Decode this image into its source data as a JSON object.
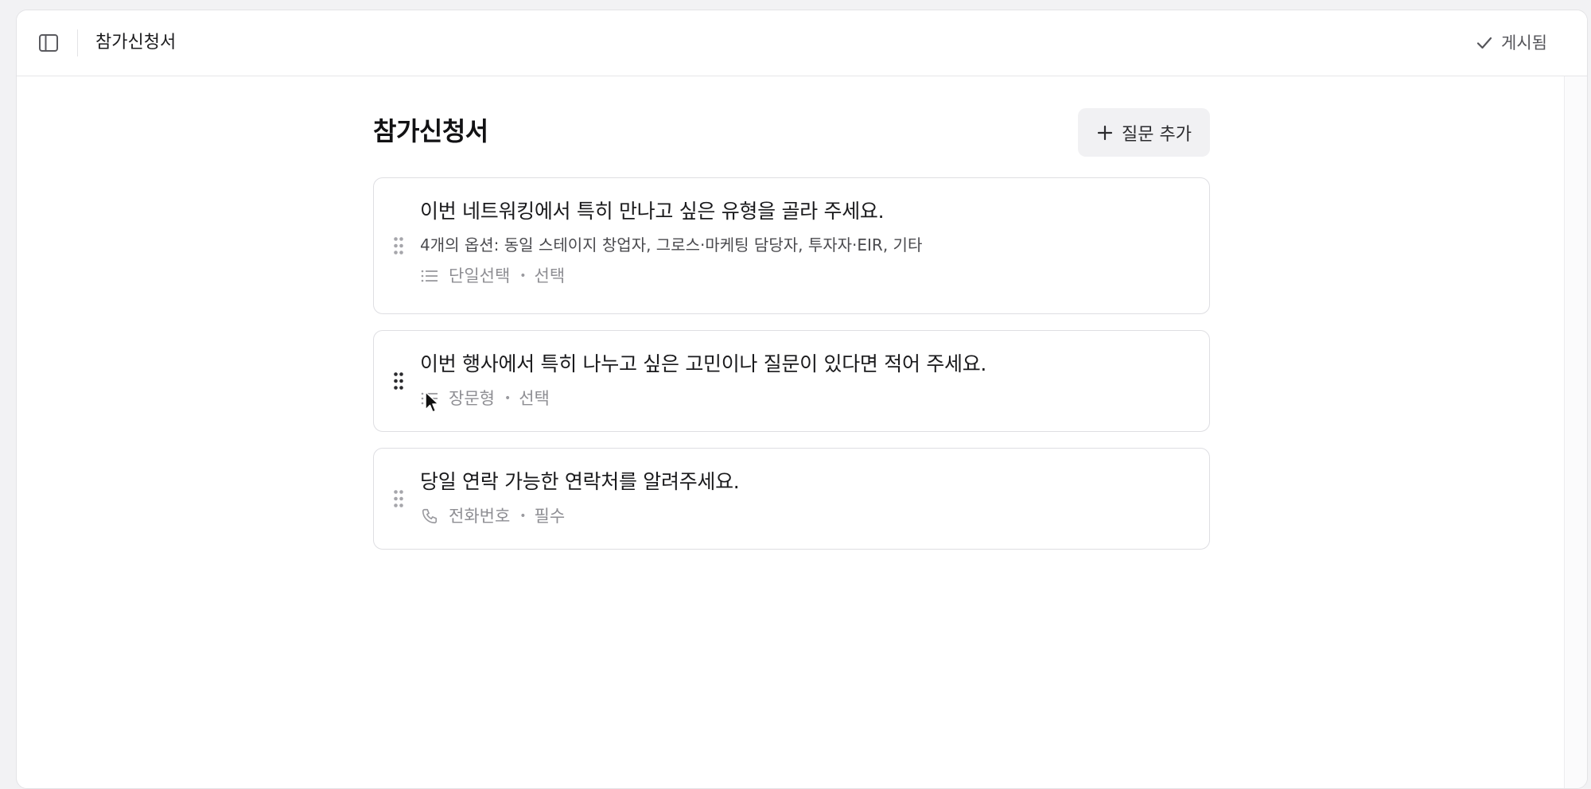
{
  "topbar": {
    "title": "참가신청서",
    "status_label": "게시됨"
  },
  "page": {
    "title": "참가신청서",
    "add_question_label": "질문 추가"
  },
  "questions": [
    {
      "title": "이번 네트워킹에서 특히 만나고 싶은 유형을 골라 주세요.",
      "options": "4개의 옵션: 동일 스테이지 창업자, 그로스·마케팅 담당자, 투자자·EIR, 기타",
      "type": "단일선택",
      "type_icon": "list-icon",
      "requirement": "선택"
    },
    {
      "title": "이번 행사에서 특히 나누고 싶은 고민이나 질문이 있다면 적어 주세요.",
      "type": "장문형",
      "type_icon": "list-icon",
      "requirement": "선택"
    },
    {
      "title": "당일 연락 가능한 연락처를 알려주세요.",
      "type": "전화번호",
      "type_icon": "phone-icon",
      "requirement": "필수"
    }
  ],
  "icons": {
    "sidebar_toggle": "sidebar-toggle-icon",
    "status": "check-icon",
    "add": "plus-icon",
    "drag": "drag-handle-icon",
    "cursor": "mouse-cursor-icon"
  }
}
